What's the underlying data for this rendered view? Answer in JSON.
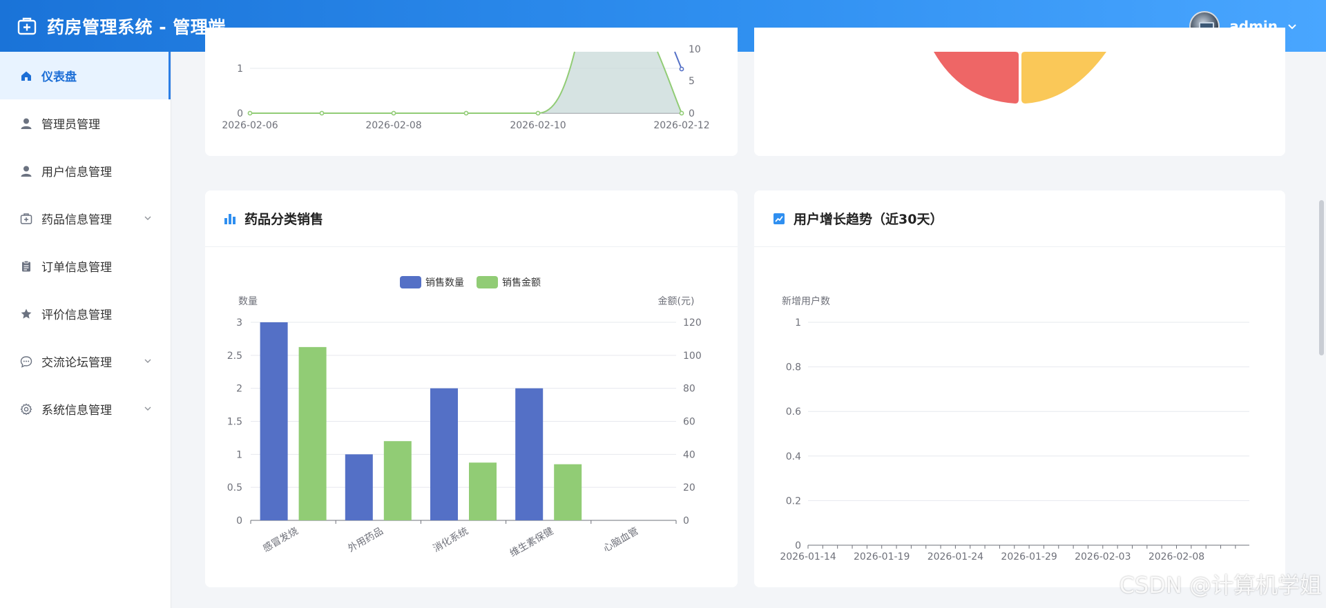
{
  "header": {
    "title": "药房管理系统 - 管理端",
    "username": "admin"
  },
  "sidebar": {
    "items": [
      {
        "label": "仪表盘",
        "icon": "home-icon",
        "active": true
      },
      {
        "label": "管理员管理",
        "icon": "user-icon"
      },
      {
        "label": "用户信息管理",
        "icon": "user-icon"
      },
      {
        "label": "药品信息管理",
        "icon": "medkit-icon",
        "expandable": true
      },
      {
        "label": "订单信息管理",
        "icon": "clipboard-icon"
      },
      {
        "label": "评价信息管理",
        "icon": "star-icon"
      },
      {
        "label": "交流论坛管理",
        "icon": "chat-icon",
        "expandable": true
      },
      {
        "label": "系统信息管理",
        "icon": "gear-icon",
        "expandable": true
      }
    ]
  },
  "top_chart": {
    "left_ticks": [
      "1",
      "0"
    ],
    "right_ticks": [
      "10",
      "5",
      "0"
    ],
    "x_labels": [
      "2026-02-06",
      "2026-02-08",
      "2026-02-10",
      "2026-02-12"
    ]
  },
  "category_card": {
    "title": "药品分类销售"
  },
  "growth_card": {
    "title": "用户增长趋势（近30天）"
  },
  "chart_data": [
    {
      "type": "bar",
      "categories": [
        "感冒发烧",
        "外用药品",
        "消化系统",
        "维生素保健",
        "心脑血管"
      ],
      "series": [
        {
          "name": "销售数量",
          "axis": "left",
          "color": "#5470c6",
          "values": [
            3,
            1,
            2,
            2,
            0
          ]
        },
        {
          "name": "销售金额",
          "axis": "right",
          "color": "#91cc75",
          "values": [
            105,
            48,
            35,
            34,
            0
          ]
        }
      ],
      "ylabel": "数量",
      "ylabel_right": "金额(元)",
      "ylim": [
        0,
        3
      ],
      "ylim_right": [
        0,
        120
      ],
      "yticks": [
        "0",
        "0.5",
        "1",
        "1.5",
        "2",
        "2.5",
        "3"
      ],
      "yticks_right": [
        "0",
        "20",
        "40",
        "60",
        "80",
        "100",
        "120"
      ],
      "legend": "top-center",
      "grid": true
    },
    {
      "type": "line",
      "ylabel": "新增用户数",
      "ylim": [
        0,
        1
      ],
      "yticks": [
        "0",
        "0.2",
        "0.4",
        "0.6",
        "0.8",
        "1"
      ],
      "x_labels": [
        "2026-01-14",
        "2026-01-19",
        "2026-01-24",
        "2026-01-29",
        "2026-02-03",
        "2026-02-08"
      ],
      "series": [],
      "grid": true
    }
  ],
  "watermark": "CSDN @计算机学姐"
}
